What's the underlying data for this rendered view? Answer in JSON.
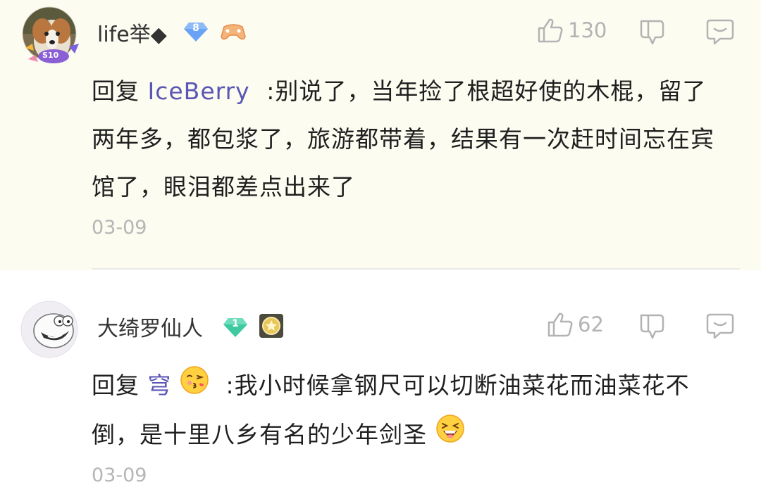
{
  "comments": [
    {
      "username": "life举◆",
      "level": "8",
      "likes": "130",
      "reply_prefix": "回复",
      "mention": "IceBerry",
      "text_after": ":别说了，当年捡了根超好使的木棍，留了两年多，都包浆了，旅游都带着，结果有一次赶时间忘在宾馆了，眼泪都差点出来了",
      "date": "03-09",
      "avatar_badge": "S10"
    },
    {
      "username": "大绮罗仙人",
      "level": "1",
      "likes": "62",
      "reply_prefix": "回复",
      "mention": "穹",
      "text_after": ":我小时候拿钢尺可以切断油菜花而油菜花不倒，是十里八乡有名的少年剑圣",
      "date": "03-09"
    }
  ],
  "colors": {
    "mention": "#5a56b4",
    "highlight_bg": "#fdfcf1",
    "meta_gray": "#b5b5b5",
    "level_8": "#6aa3f5",
    "level_1": "#3ec9a0"
  },
  "icons": [
    "thumbs-up-icon",
    "thumbs-down-icon",
    "reply-bubble-icon",
    "level-diamond-icon",
    "controller-badge-icon",
    "star-medal-badge-icon",
    "kissing-emoji-icon",
    "laughing-emoji-icon"
  ]
}
